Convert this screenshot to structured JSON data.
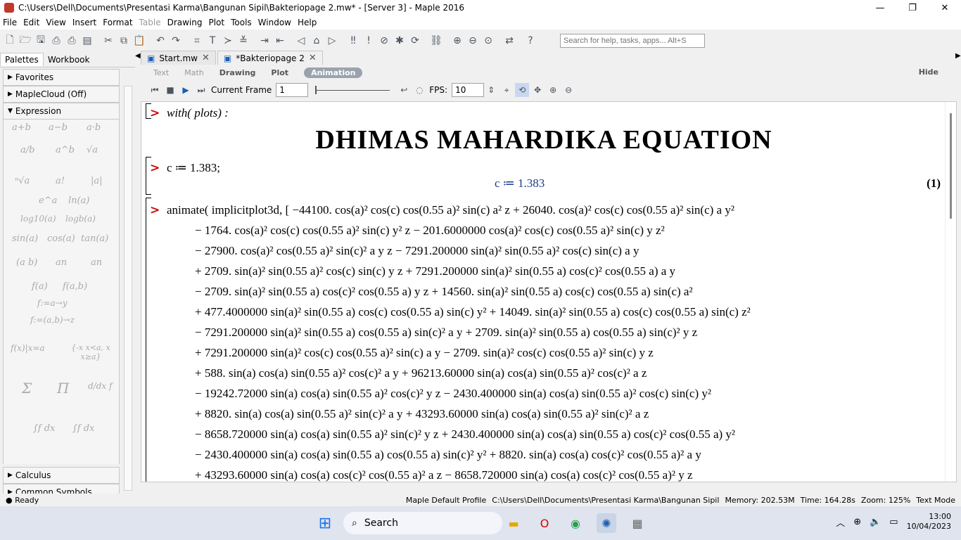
{
  "window": {
    "title": "C:\\Users\\Dell\\Documents\\Presentasi Karma\\Bangunan Sipil\\Bakteriopage 2.mw* - [Server 3] - Maple 2016"
  },
  "menu": [
    "File",
    "Edit",
    "View",
    "Insert",
    "Format",
    "Table",
    "Drawing",
    "Plot",
    "Tools",
    "Window",
    "Help"
  ],
  "search": {
    "placeholder": "Search for help, tasks, apps... Alt+S"
  },
  "palette": {
    "tabs": [
      "Palettes",
      "Workbook"
    ],
    "sections": {
      "favorites": "Favorites",
      "maplecloud": "MapleCloud (Off)",
      "expression": "Expression",
      "calculus": "Calculus",
      "common": "Common Symbols"
    },
    "expr_items": [
      "a+b",
      "a−b",
      "a·b",
      "a/b",
      "a^b",
      "√a",
      "ⁿ√a",
      "a!",
      "|a|",
      "e^a",
      "ln(a)",
      "log10(a)",
      "logb(a)",
      "sin(a)",
      "cos(a)",
      "tan(a)",
      "(a b)",
      "an",
      "an",
      "f(a)",
      "f(a,b)",
      "f:=a→y",
      "f:=(a,b)→z",
      "f(x)|x=a",
      "{-x x<a, x x≥a}",
      "Σ",
      "Π",
      "d/dx f",
      "∫f dx",
      "∫f dx"
    ]
  },
  "doc_tabs": [
    {
      "label": "Start.mw"
    },
    {
      "label": "*Bakteriopage 2"
    }
  ],
  "context_bar": {
    "items": [
      "Text",
      "Math",
      "Drawing",
      "Plot"
    ],
    "active": "Animation",
    "hide": "Hide"
  },
  "anim": {
    "current_frame_label": "Current Frame",
    "current_frame": "1",
    "fps_label": "FPS:",
    "fps": "10"
  },
  "doc": {
    "prompt": ">",
    "line1": "with( plots) :",
    "heading": "DHIMAS MAHARDIKA EQUATION",
    "line2": "c ≔ 1.383;",
    "result": "c ≔ 1.383",
    "eq_label": "(1)",
    "anim_lines": [
      "animate( implicitplot3d, [ −44100. cos(a)² cos(c) cos(0.55 a)² sin(c) a² z + 26040. cos(a)² cos(c) cos(0.55 a)² sin(c) a y²",
      "− 1764. cos(a)² cos(c) cos(0.55 a)² sin(c) y² z − 201.6000000 cos(a)² cos(c) cos(0.55 a)² sin(c) y z²",
      "− 27900. cos(a)² cos(0.55 a)² sin(c)² a y z − 7291.200000 sin(a)² sin(0.55 a)² cos(c) sin(c) a y",
      "+ 2709. sin(a)² sin(0.55 a)² cos(c) sin(c) y z + 7291.200000 sin(a)² sin(0.55 a) cos(c)² cos(0.55 a) a y",
      "− 2709. sin(a)² sin(0.55 a) cos(c)² cos(0.55 a) y z + 14560. sin(a)² sin(0.55 a) cos(c) cos(0.55 a) sin(c) a²",
      "+ 477.4000000 sin(a)² sin(0.55 a) cos(c) cos(0.55 a) sin(c) y² + 14049. sin(a)² sin(0.55 a) cos(c) cos(0.55 a) sin(c) z²",
      "− 7291.200000 sin(a)² sin(0.55 a) cos(0.55 a) sin(c)² a y + 2709. sin(a)² sin(0.55 a) cos(0.55 a) sin(c)² y z",
      "+ 7291.200000 sin(a)² cos(c) cos(0.55 a)² sin(c) a y − 2709. sin(a)² cos(c) cos(0.55 a)² sin(c) y z",
      "+ 588. sin(a) cos(a) sin(0.55 a)² cos(c)² a y + 96213.60000 sin(a) cos(a) sin(0.55 a)² cos(c)² a z",
      "− 19242.72000 sin(a) cos(a) sin(0.55 a)² cos(c)² y z − 2430.400000 sin(a) cos(a) sin(0.55 a)² cos(c) sin(c) y²",
      "+ 8820. sin(a) cos(a) sin(0.55 a)² sin(c)² a y + 43293.60000 sin(a) cos(a) sin(0.55 a)² sin(c)² a z",
      "− 8658.720000 sin(a) cos(a) sin(0.55 a)² sin(c)² y z + 2430.400000 sin(a) cos(a) sin(0.55 a) cos(c)² cos(0.55 a) y²",
      "− 2430.400000 sin(a) cos(a) sin(0.55 a) cos(0.55 a) sin(c)² y² + 8820. sin(a) cos(a) cos(c)² cos(0.55 a)² a y",
      "+ 43293.60000 sin(a) cos(a) cos(c)² cos(0.55 a)² a z − 8658.720000 sin(a) cos(a) cos(c)² cos(0.55 a)² y z"
    ]
  },
  "status": {
    "ready": "Ready",
    "profile": "Maple Default Profile",
    "path": "C:\\Users\\Dell\\Documents\\Presentasi Karma\\Bangunan Sipil",
    "memory": "Memory: 202.53M",
    "time": "Time: 164.28s",
    "zoom": "Zoom: 125%",
    "mode": "Text Mode"
  },
  "taskbar": {
    "search": "Search",
    "time": "13:00",
    "date": "10/04/2023"
  }
}
